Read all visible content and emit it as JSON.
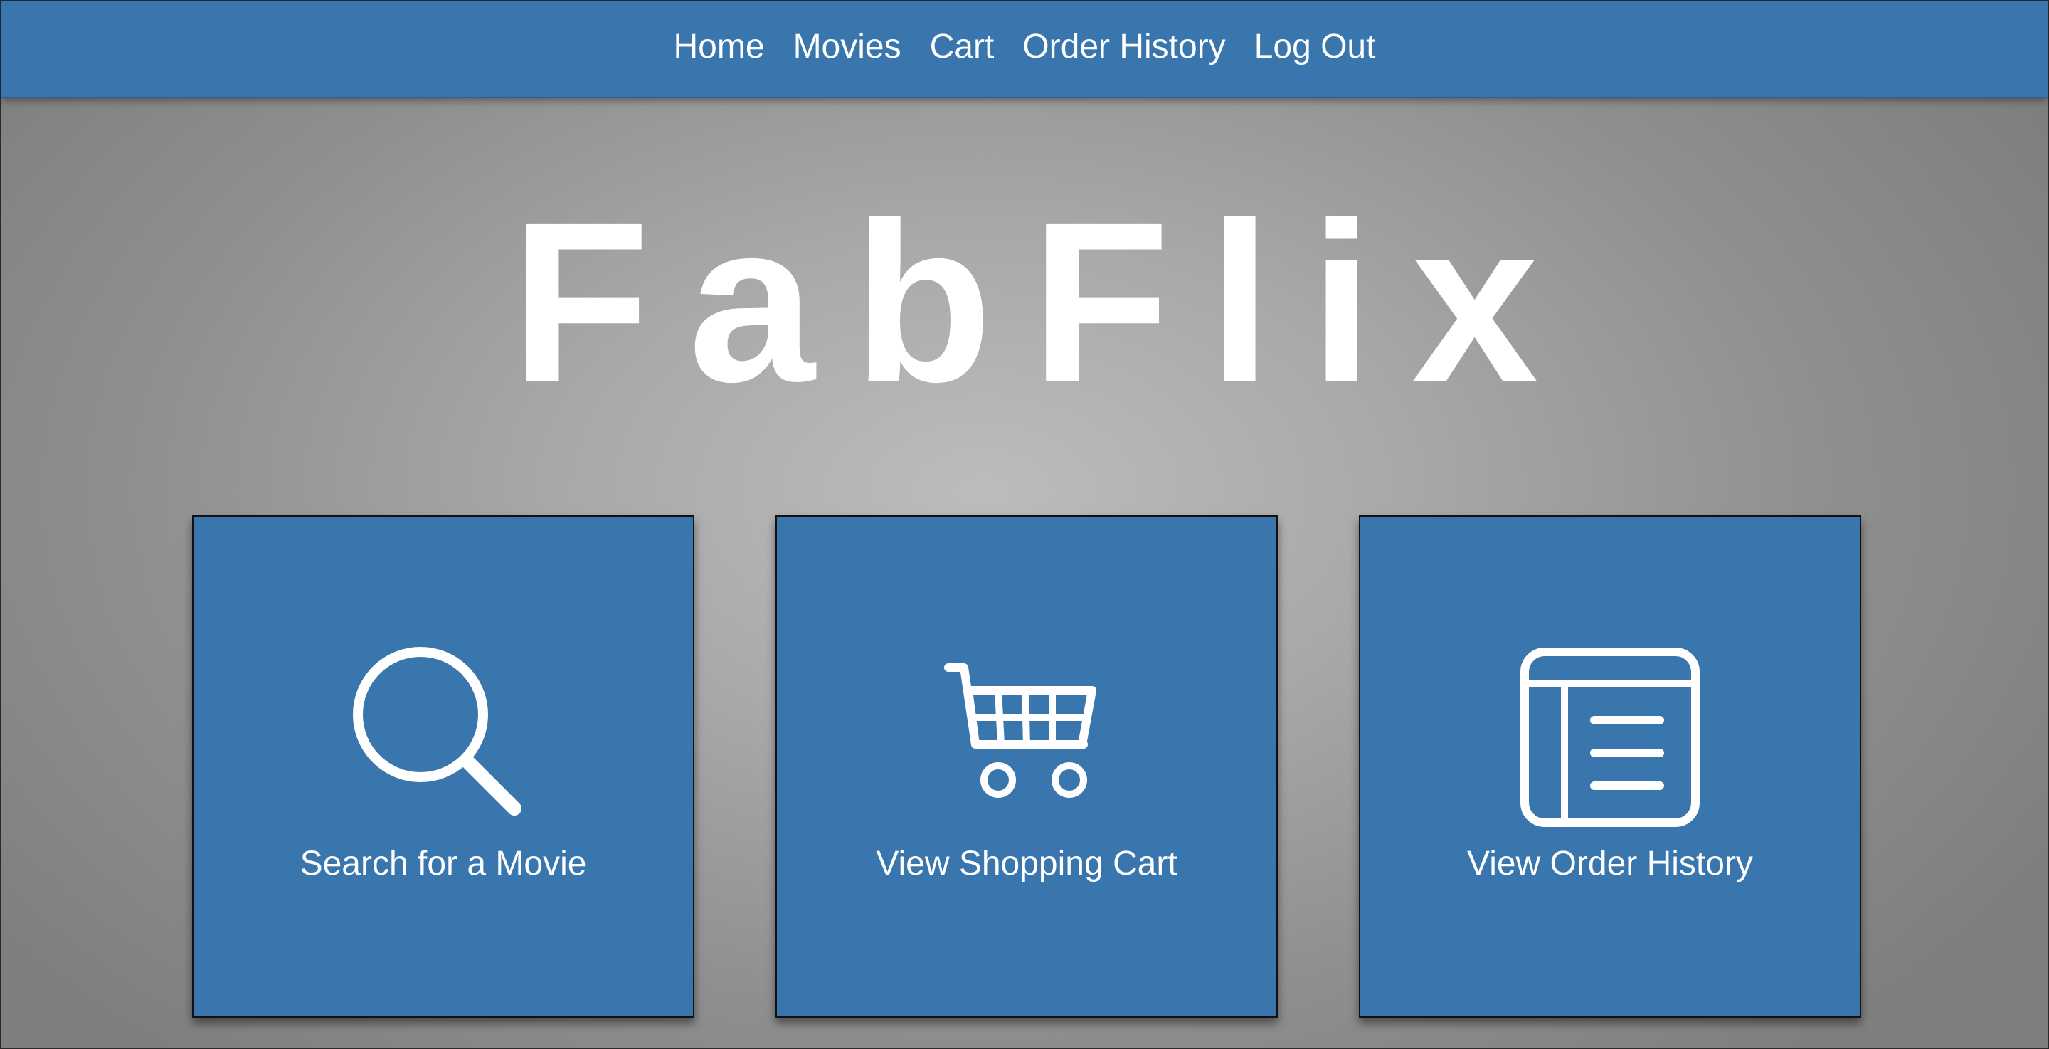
{
  "nav": {
    "items": [
      {
        "label": "Home"
      },
      {
        "label": "Movies"
      },
      {
        "label": "Cart"
      },
      {
        "label": "Order History"
      },
      {
        "label": "Log Out"
      }
    ]
  },
  "logo": {
    "text": "FabFlix"
  },
  "tiles": [
    {
      "label": "Search for a Movie",
      "icon": "search-icon"
    },
    {
      "label": "View Shopping Cart",
      "icon": "cart-icon"
    },
    {
      "label": "View Order History",
      "icon": "order-history-icon"
    }
  ],
  "colors": {
    "accent": "#3a76ae",
    "text": "#ffffff",
    "background": "#a9a8a8"
  }
}
